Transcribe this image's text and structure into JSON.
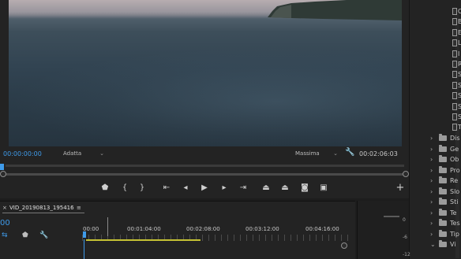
{
  "program_monitor": {
    "timecode_current": "00:00:00:00",
    "fit_select": "Adatta",
    "quality_select": "Massima",
    "timecode_duration": "00:02:06:03"
  },
  "transport": {
    "buttons": [
      {
        "name": "add-marker-icon",
        "glyph": "⬢"
      },
      {
        "name": "mark-in-icon",
        "glyph": "{"
      },
      {
        "name": "mark-out-icon",
        "glyph": "}"
      },
      {
        "name": "go-to-in-icon",
        "glyph": "|←"
      },
      {
        "name": "step-back-icon",
        "glyph": "◂|"
      },
      {
        "name": "play-icon",
        "glyph": "▶"
      },
      {
        "name": "step-forward-icon",
        "glyph": "|▸"
      },
      {
        "name": "go-to-out-icon",
        "glyph": "→|"
      },
      {
        "name": "lift-icon",
        "glyph": "⧉"
      },
      {
        "name": "extract-icon",
        "glyph": "⧉"
      },
      {
        "name": "export-frame-icon",
        "glyph": "◙"
      },
      {
        "name": "compare-view-icon",
        "glyph": "▣"
      },
      {
        "name": "add-button-icon",
        "glyph": "+"
      }
    ]
  },
  "timeline": {
    "sequence_name": "VID_20190813_195416",
    "close_glyph": "×",
    "menu_glyph": "≡",
    "timecode": "00",
    "ticks": [
      "00:00",
      "00:01:04:00",
      "00:02:08:00",
      "00:03:12:00",
      "00:04:16:00"
    ]
  },
  "meters": {
    "db_labels": [
      "0",
      "-6",
      "-12"
    ]
  },
  "project_panel": {
    "top_files": [
      "C",
      "B",
      "E",
      "L",
      "I",
      "R",
      "S",
      "S",
      "S",
      "S",
      "S",
      "T"
    ],
    "folders": [
      "Dis",
      "Ge",
      "Ob",
      "Pro",
      "Re",
      "Slo",
      "Sti",
      "Te",
      "Tes",
      "Tip",
      "Vi"
    ]
  }
}
